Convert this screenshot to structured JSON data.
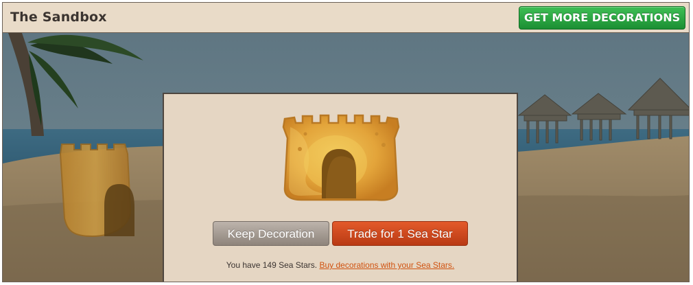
{
  "app": {
    "title": "The Sandbox"
  },
  "header": {
    "get_more_label": "GET MORE DECORATIONS"
  },
  "dialog": {
    "keep_label": "Keep Decoration",
    "trade_label": "Trade for 1 Sea Star",
    "balance_text": "You have 149 Sea Stars.",
    "buy_link_text": "Buy decorations with your Sea Stars."
  },
  "colors": {
    "trade_button": "#c9431b",
    "keep_button": "#a59c94",
    "get_more_button": "#27a63f",
    "link": "#d0520f"
  },
  "icons": [
    "sand-castle-icon"
  ]
}
